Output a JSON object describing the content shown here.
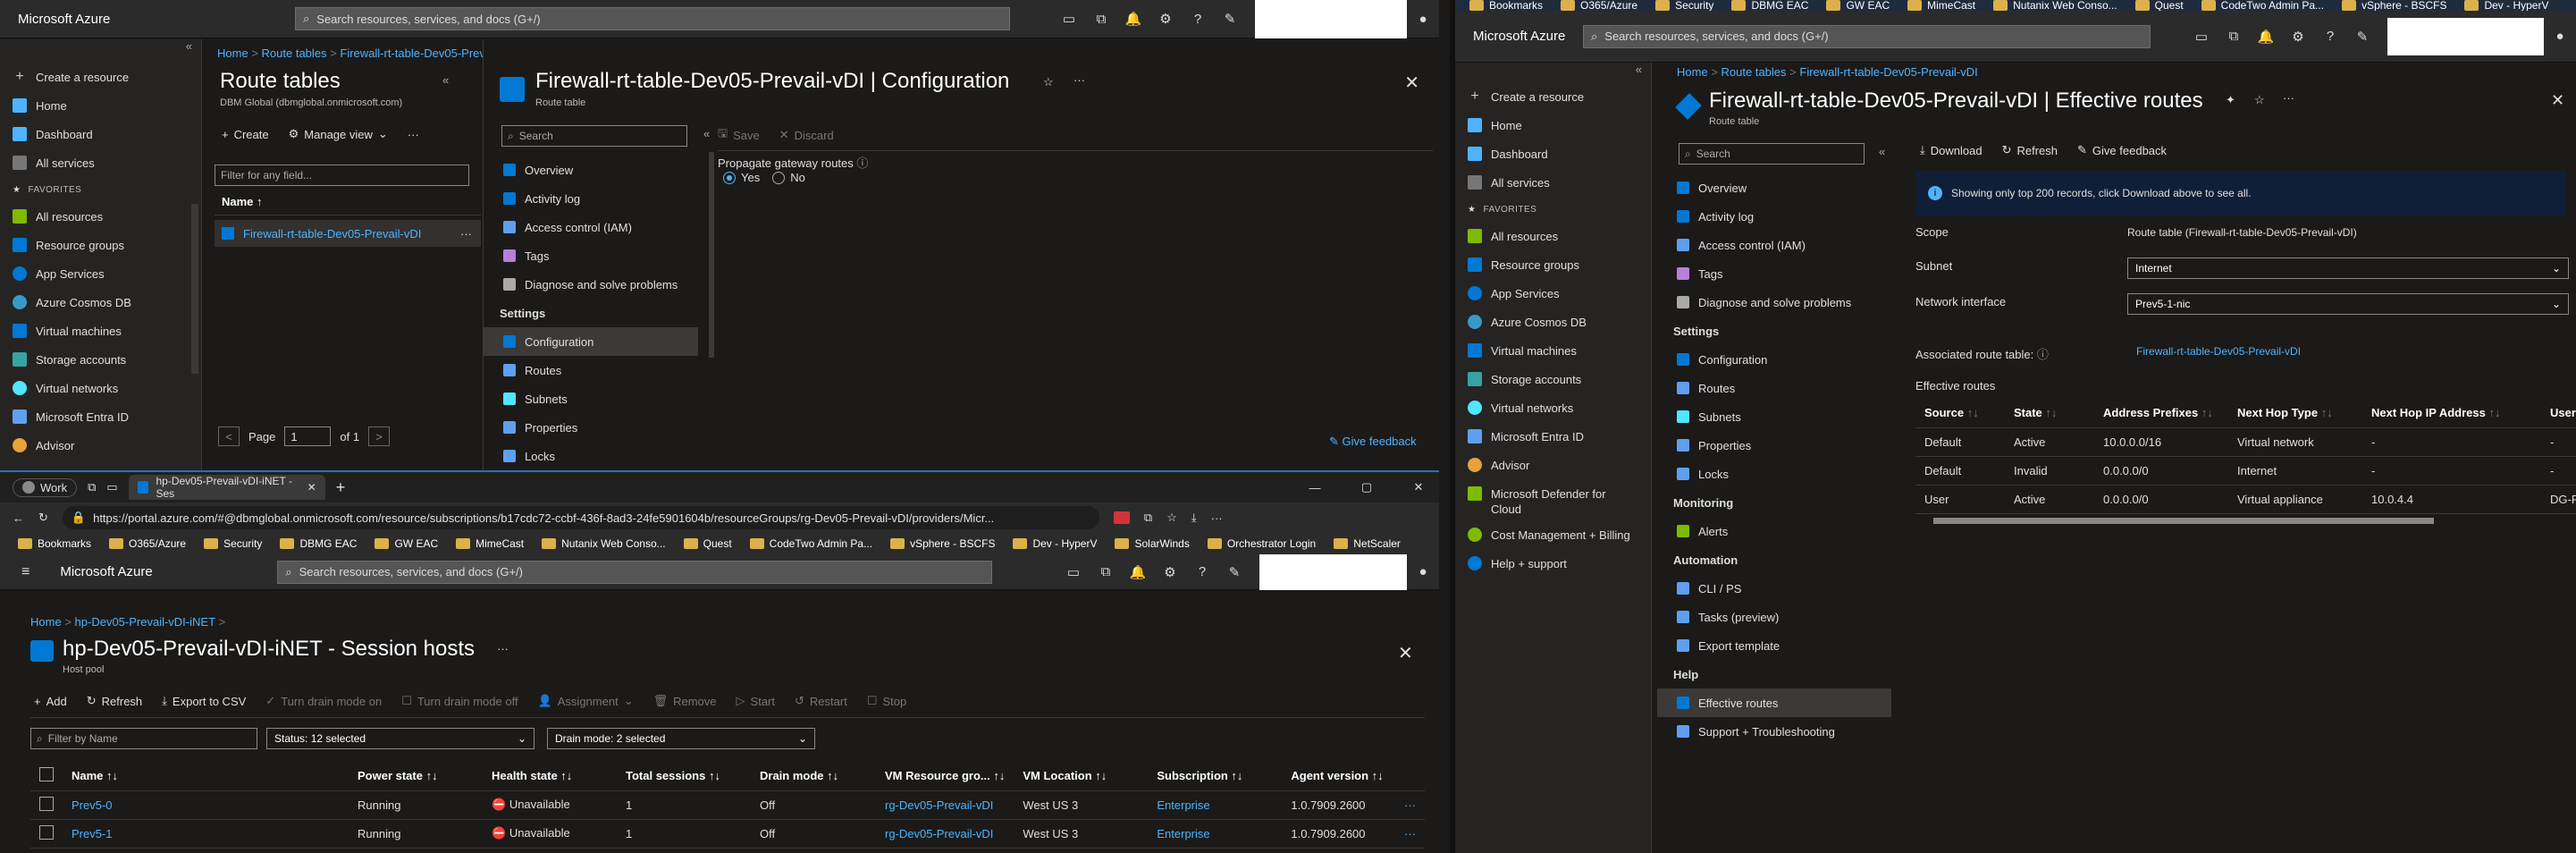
{
  "top_bookmarks": [
    "Bookmarks",
    "O365/Azure",
    "Security",
    "DBMG EAC",
    "GW EAC",
    "MimeCast",
    "Nutanix Web Conso...",
    "Quest",
    "CodeTwo Admin Pa...",
    "vSphere - BSCFS",
    "Dev - HyperV"
  ],
  "azure": {
    "brand": "Microsoft Azure",
    "search": "Search resources, services, and docs (G+/)"
  },
  "left_nav": {
    "create": "Create a resource",
    "home": "Home",
    "dashboard": "Dashboard",
    "all_services": "All services",
    "favorites": "FAVORITES",
    "items": [
      "All resources",
      "Resource groups",
      "App Services",
      "Azure Cosmos DB",
      "Virtual machines",
      "Storage accounts",
      "Virtual networks",
      "Microsoft Entra ID",
      "Advisor"
    ]
  },
  "w1": {
    "breadcrumb": [
      "Home",
      ">",
      "Route tables",
      ">",
      "Firewall-rt-table-Dev05-Prevail-vDI"
    ],
    "list_title": "Route tables",
    "list_sub": "DBM Global (dbmglobal.onmicrosoft.com)",
    "create": "Create",
    "manage_view": "Manage view",
    "filter": "Filter for any field...",
    "name_col": "Name ↑",
    "row": "Firewall-rt-table-Dev05-Prevail-vDI",
    "page_label": "Page",
    "page_val": "1",
    "of": "of 1",
    "detail_title": "Firewall-rt-table-Dev05-Prevail-vDI | Configuration",
    "detail_sub": "Route table",
    "search": "Search",
    "save": "Save",
    "discard": "Discard",
    "menu": [
      "Overview",
      "Activity log",
      "Access control (IAM)",
      "Tags",
      "Diagnose and solve problems"
    ],
    "settings": "Settings",
    "settings_items": [
      "Configuration",
      "Routes",
      "Subnets",
      "Properties",
      "Locks"
    ],
    "propagate": "Propagate gateway routes",
    "yes": "Yes",
    "no": "No",
    "feedback": "Give feedback"
  },
  "w2": {
    "work": "Work",
    "tab": "hp-Dev05-Prevail-vDI-iNET - Ses",
    "url": "https://portal.azure.com/#@dbmglobal.onmicrosoft.com/resource/subscriptions/b17cdc72-ccbf-436f-8ad3-24fe5901604b/resourceGroups/rg-Dev05-Prevail-vDI/providers/Micr...",
    "bookmarks": [
      "Bookmarks",
      "O365/Azure",
      "Security",
      "DBMG EAC",
      "GW EAC",
      "MimeCast",
      "Nutanix Web Conso...",
      "Quest",
      "CodeTwo Admin Pa...",
      "vSphere - BSCFS",
      "Dev - HyperV",
      "SolarWinds",
      "Orchestrator Login",
      "NetScaler"
    ],
    "breadcrumb": [
      "Home",
      ">",
      "hp-Dev05-Prevail-vDI-iNET",
      ">"
    ],
    "title": "hp-Dev05-Prevail-vDI-iNET - Session hosts",
    "sub": "Host pool",
    "toolbar": [
      "Add",
      "Refresh",
      "Export to CSV",
      "Turn drain mode on",
      "Turn drain mode off",
      "Assignment",
      "Remove",
      "Start",
      "Restart",
      "Stop"
    ],
    "filter": "Filter by Name",
    "status_dd": "Status: 12 selected",
    "drain_dd": "Drain mode: 2 selected",
    "cols": [
      "Name ↑↓",
      "Power state ↑↓",
      "Health state ↑↓",
      "Total sessions ↑↓",
      "Drain mode ↑↓",
      "VM Resource gro... ↑↓",
      "VM Location ↑↓",
      "Subscription ↑↓",
      "Agent version ↑↓"
    ],
    "rows": [
      [
        "Prev5-0",
        "Running",
        "Unavailable",
        "1",
        "Off",
        "rg-Dev05-Prevail-vDI",
        "West US 3",
        "Enterprise",
        "1.0.7909.2600"
      ],
      [
        "Prev5-1",
        "Running",
        "Unavailable",
        "1",
        "Off",
        "rg-Dev05-Prevail-vDI",
        "West US 3",
        "Enterprise",
        "1.0.7909.2600"
      ]
    ]
  },
  "w3": {
    "breadcrumb": [
      "Home",
      ">",
      "Route tables",
      ">",
      "Firewall-rt-table-Dev05-Prevail-vDI"
    ],
    "title": "Firewall-rt-table-Dev05-Prevail-vDI | Effective routes",
    "sub": "Route table",
    "search": "Search",
    "menu": [
      "Overview",
      "Activity log",
      "Access control (IAM)",
      "Tags",
      "Diagnose and solve problems"
    ],
    "settings": "Settings",
    "settings_items": [
      "Configuration",
      "Routes",
      "Subnets",
      "Properties",
      "Locks"
    ],
    "monitoring": "Monitoring",
    "alerts": "Alerts",
    "automation": "Automation",
    "automation_items": [
      "CLI / PS",
      "Tasks (preview)",
      "Export template"
    ],
    "help": "Help",
    "help_items": [
      "Effective routes",
      "Support + Troubleshooting"
    ],
    "nav_extra": [
      "Microsoft Defender for Cloud",
      "Cost Management + Billing",
      "Help + support"
    ],
    "download": "Download",
    "refresh": "Refresh",
    "feedback": "Give feedback",
    "info": "Showing only top 200 records, click Download above to see all.",
    "scope_l": "Scope",
    "scope_v": "Route table (Firewall-rt-table-Dev05-Prevail-vDI)",
    "subnet_l": "Subnet",
    "subnet_v": "Internet",
    "nic_l": "Network interface",
    "nic_v": "Prev5-1-nic",
    "assoc_l": "Associated route table:",
    "assoc_v": "Firewall-rt-table-Dev05-Prevail-vDI",
    "eff_l": "Effective routes",
    "cols": [
      "Source",
      "State",
      "Address Prefixes",
      "Next Hop Type",
      "Next Hop IP Address",
      "User"
    ],
    "rows": [
      [
        "Default",
        "Active",
        "10.0.0.0/16",
        "Virtual network",
        "-",
        "-"
      ],
      [
        "Default",
        "Invalid",
        "0.0.0.0/0",
        "Internet",
        "-",
        "-"
      ],
      [
        "User",
        "Active",
        "0.0.0.0/0",
        "Virtual appliance",
        "10.0.4.4",
        "DG-F"
      ]
    ]
  }
}
